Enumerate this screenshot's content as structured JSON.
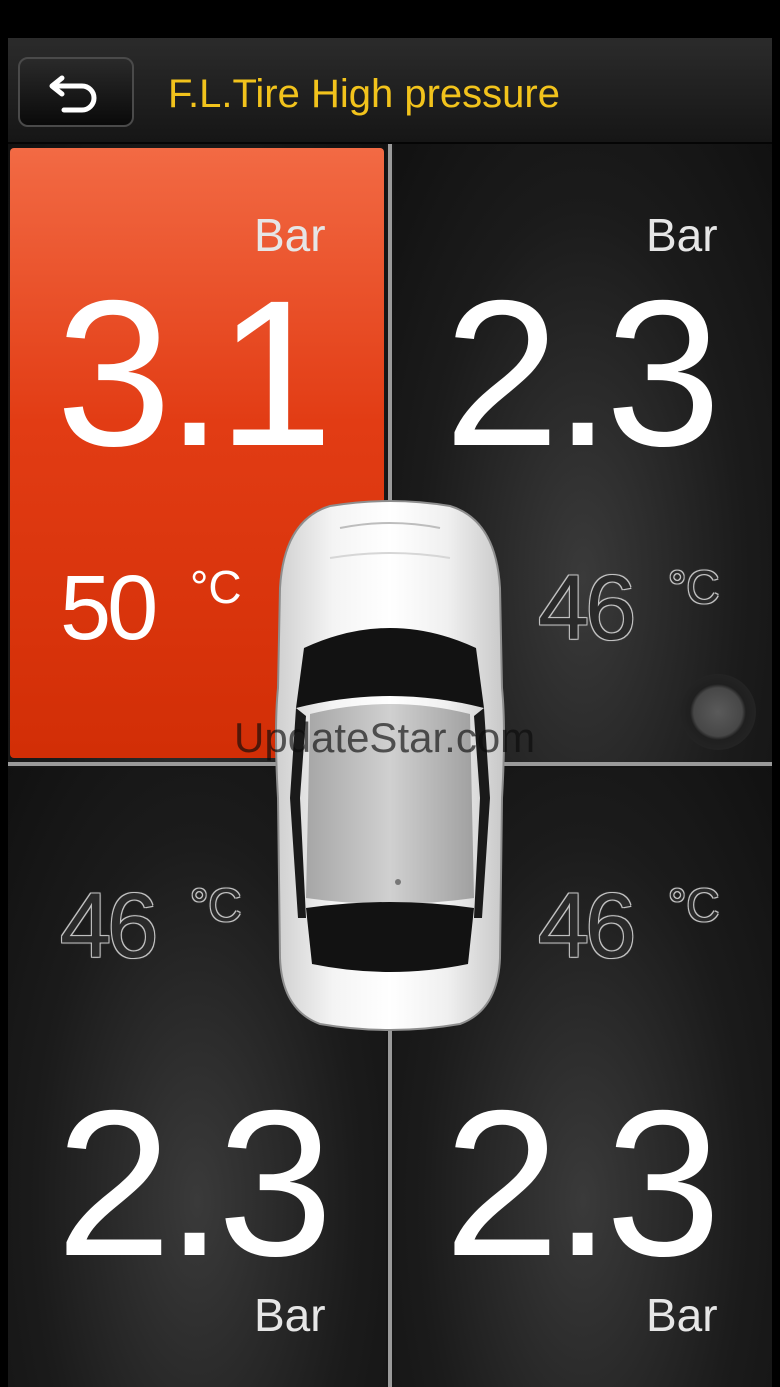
{
  "header": {
    "title": "F.L.Tire High pressure",
    "title_color": "#f2c31c",
    "back_icon": "back-arrow-icon"
  },
  "tires": {
    "front_left": {
      "pressure": "3.1",
      "pressure_unit": "Bar",
      "temperature": "50",
      "temperature_unit": "°C",
      "alarm": true,
      "alarm_color": "#e23c14"
    },
    "front_right": {
      "pressure": "2.3",
      "pressure_unit": "Bar",
      "temperature": "46",
      "temperature_unit": "°C",
      "alarm": false
    },
    "rear_left": {
      "pressure": "2.3",
      "pressure_unit": "Bar",
      "temperature": "46",
      "temperature_unit": "°C",
      "alarm": false
    },
    "rear_right": {
      "pressure": "2.3",
      "pressure_unit": "Bar",
      "temperature": "46",
      "temperature_unit": "°C",
      "alarm": false
    }
  },
  "car_icon": "car-top-view-icon",
  "floating_button_icon": "assistive-touch-icon",
  "watermark": "UpdateStar.com"
}
